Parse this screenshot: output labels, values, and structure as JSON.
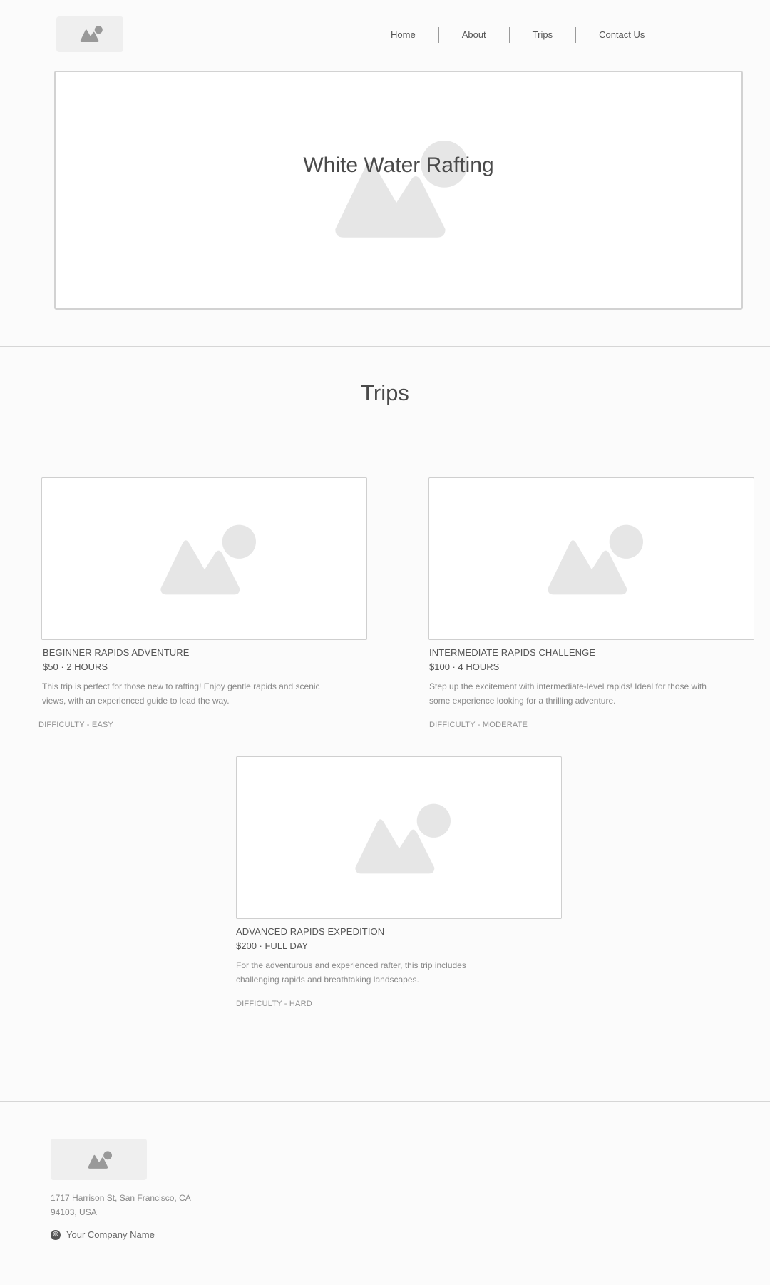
{
  "header": {
    "nav": [
      "Home",
      "About",
      "Trips",
      "Contact Us"
    ]
  },
  "hero": {
    "title": "White Water Rafting"
  },
  "trips_section": {
    "title": "Trips",
    "trips": [
      {
        "title": "BEGINNER RAPIDS ADVENTURE",
        "price": "$50",
        "duration": "2 HOURS",
        "description": "This trip is perfect for those new to rafting! Enjoy gentle rapids and scenic views, with an experienced guide to lead the way.",
        "difficulty": "DIFFICULTY - EASY"
      },
      {
        "title": "INTERMEDIATE RAPIDS CHALLENGE",
        "price": "$100",
        "duration": "4 HOURS",
        "description": "Step up the excitement with intermediate-level rapids! Ideal for those with some experience looking for a thrilling adventure.",
        "difficulty": "DIFFICULTY - MODERATE"
      },
      {
        "title": "ADVANCED RAPIDS EXPEDITION",
        "price": "$200",
        "duration": "FULL DAY",
        "description": "For the adventurous and experienced rafter, this trip includes challenging rapids and breathtaking landscapes.",
        "difficulty": "DIFFICULTY - HARD"
      }
    ]
  },
  "footer": {
    "address": "1717 Harrison St, San Francisco, CA 94103, USA",
    "copyright_symbol": "©",
    "company": "Your Company Name"
  },
  "colors": {
    "background": "#fbfbfb",
    "placeholder": "#e6e6e6",
    "border": "#d2d2d2",
    "text": "#555555"
  },
  "icons": [
    "image-placeholder-icon",
    "copyright-icon"
  ]
}
